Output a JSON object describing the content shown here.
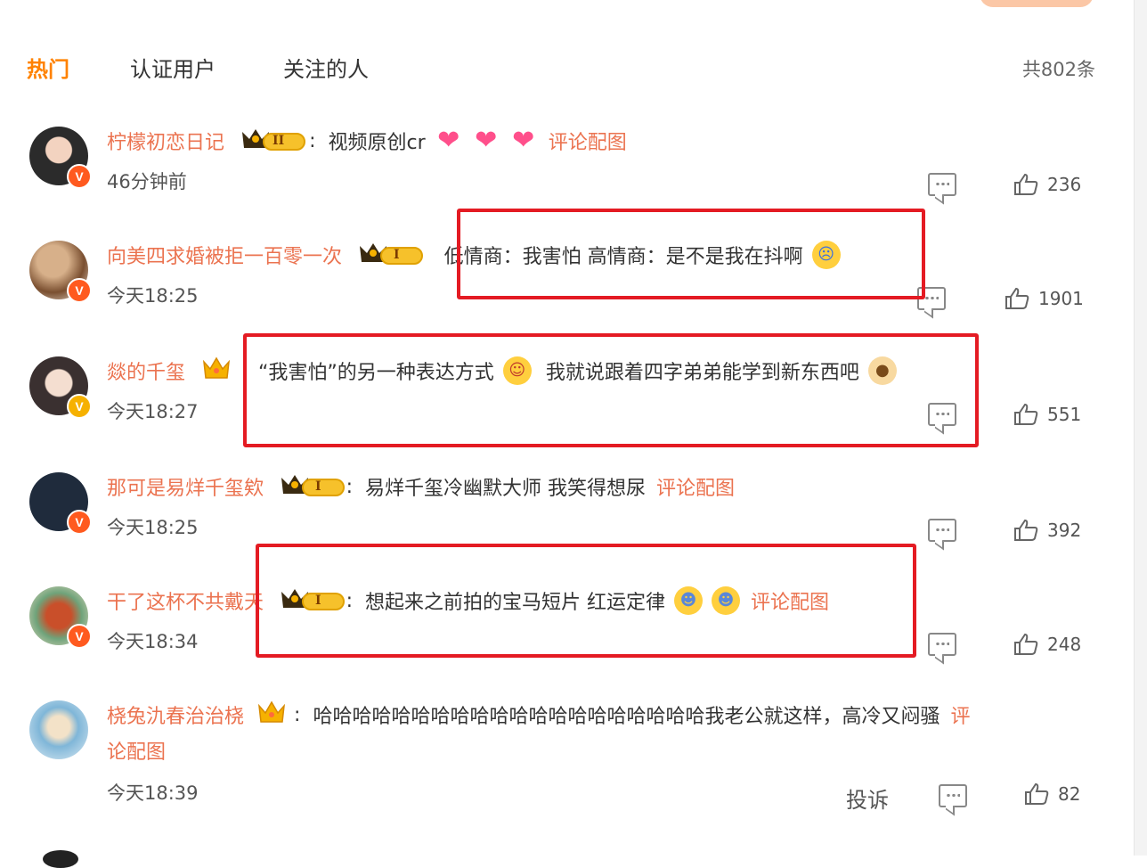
{
  "tabs": [
    {
      "label": "热门",
      "active": true
    },
    {
      "label": "认证用户",
      "active": false
    },
    {
      "label": "关注的人",
      "active": false
    }
  ],
  "total_count": "共802条",
  "accent_color": "#ff8200",
  "username_color": "#eb7350",
  "highlight_box_color": "#e41b23",
  "comments": [
    {
      "username": "柠檬初恋日记",
      "level_badge": "II",
      "text": "视频原创cr",
      "emojis": [
        "heart-emoji",
        "heart-emoji",
        "heart-emoji"
      ],
      "link": "评论配图",
      "time": "46分钟前",
      "likes": "236",
      "verified": "V"
    },
    {
      "username": "向美四求婚被拒一百零一次",
      "level_badge": "I",
      "text": "低情商：我害怕 高情商：是不是我在抖啊",
      "emojis": [
        "crying-emoji"
      ],
      "link": "",
      "time": "今天18:25",
      "likes": "1901",
      "verified": "V"
    },
    {
      "username": "燚的千玺",
      "level_badge": "",
      "text_a": "“我害怕”的另一种表达方式",
      "text_b": "我就说跟着四字弟弟能学到新东西吧",
      "emojis": [
        "grin-emoji",
        "dog-emoji"
      ],
      "link": "",
      "time": "今天18:27",
      "likes": "551",
      "verified": "V"
    },
    {
      "username": "那可是易烊千玺欸",
      "level_badge": "I",
      "text": "易烊千玺冷幽默大师 我笑得想尿",
      "emojis": [],
      "link": "评论配图",
      "time": "今天18:25",
      "likes": "392",
      "verified": "V"
    },
    {
      "username": "干了这杯不共戴天",
      "level_badge": "I",
      "text": "想起来之前拍的宝马短片 红运定律",
      "emojis": [
        "laugh-cry-emoji",
        "laugh-cry-emoji"
      ],
      "link": "评论配图",
      "time": "今天18:34",
      "likes": "248",
      "verified": "V"
    },
    {
      "username": "桡兔氿春治治桡",
      "level_badge": "",
      "text": "哈哈哈哈哈哈哈哈哈哈哈哈哈哈哈哈哈哈哈哈我老公就这样，高冷又闷骚",
      "link_a": "评",
      "link_b": "论配图",
      "time": "今天18:39",
      "likes": "82",
      "report": "投诉"
    }
  ]
}
